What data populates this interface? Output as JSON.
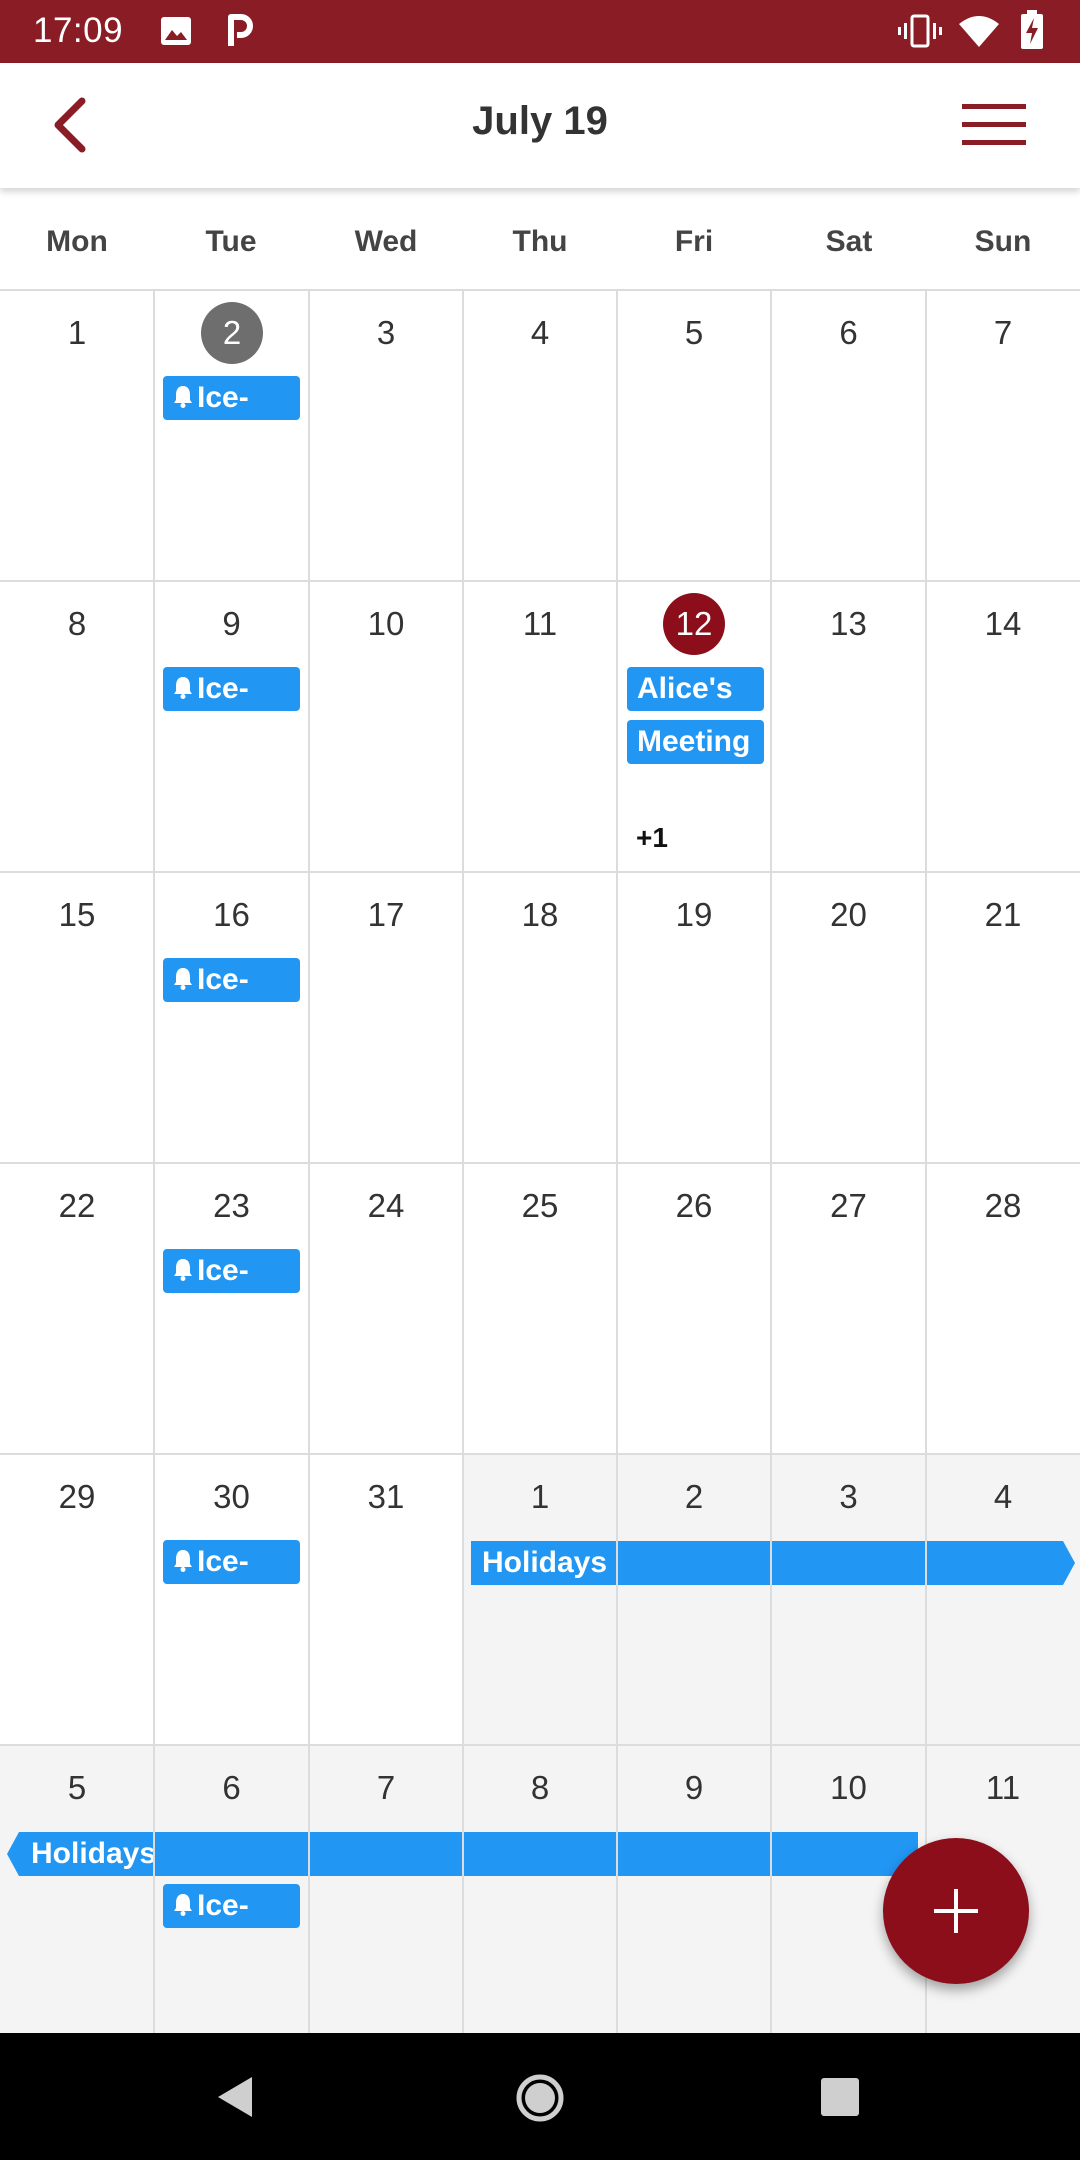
{
  "status_bar": {
    "time": "17:09",
    "icons": [
      "image-icon",
      "parking-icon",
      "vibrate-icon",
      "wifi-icon",
      "battery-charging-icon"
    ]
  },
  "app_bar": {
    "title": "July 19",
    "back_icon": "chevron-left-icon",
    "menu_icon": "hamburger-menu-icon"
  },
  "weekdays": [
    "Mon",
    "Tue",
    "Wed",
    "Thu",
    "Fri",
    "Sat",
    "Sun"
  ],
  "weeks": [
    [
      "1",
      "2",
      "3",
      "4",
      "5",
      "6",
      "7"
    ],
    [
      "8",
      "9",
      "10",
      "11",
      "12",
      "13",
      "14"
    ],
    [
      "15",
      "16",
      "17",
      "18",
      "19",
      "20",
      "21"
    ],
    [
      "22",
      "23",
      "24",
      "25",
      "26",
      "27",
      "28"
    ],
    [
      "29",
      "30",
      "31",
      "1",
      "2",
      "3",
      "4"
    ],
    [
      "5",
      "6",
      "7",
      "8",
      "9",
      "10",
      "11"
    ]
  ],
  "events": {
    "ice_label": "Ice-",
    "alices": "Alice's",
    "meeting": "Meeting",
    "more": "+1",
    "holidays": "Holidays"
  },
  "colors": {
    "brand": "#891c25",
    "today": "#8b0e1a",
    "selected": "#6e6e6e",
    "event": "#2196f3",
    "outside_month_bg": "#f4f4f4"
  },
  "fab": {
    "icon": "plus-icon"
  },
  "nav_bar": {
    "icons": [
      "nav-back-icon",
      "nav-home-icon",
      "nav-recents-icon"
    ]
  }
}
